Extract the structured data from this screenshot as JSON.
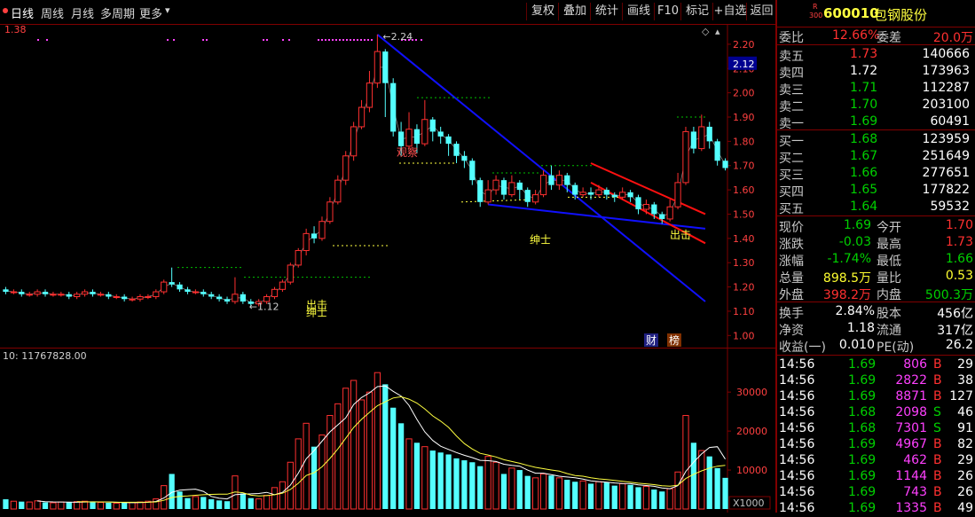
{
  "toolbar": {
    "left": [
      {
        "label": "日线",
        "active": true
      },
      {
        "label": "周线"
      },
      {
        "label": "月线"
      },
      {
        "label": "多周期"
      },
      {
        "label": "更多"
      }
    ],
    "right": [
      "复权",
      "叠加",
      "统计",
      "画线",
      "F10",
      "标记",
      "+自选",
      "返回"
    ]
  },
  "chart_header": {
    "price_label": "1.38",
    "volume_label": "10: 11767828.00",
    "current_price_tag": "2.12",
    "high_marker": "2.24",
    "low_marker": "1.12",
    "volume_unit": "X1000",
    "badge_cai": "财",
    "badge_bang": "榜"
  },
  "annotations": {
    "guancha": "观察",
    "chuji_right": "出击",
    "shenshi_mid": "绅士",
    "chuji_left": "出击",
    "shenshi_left": "绅士"
  },
  "chart_data": [
    {
      "type": "line",
      "title": "",
      "y_axis_labels": [
        "2.20",
        "2.10",
        "2.00",
        "1.90",
        "1.80",
        "1.70",
        "1.60",
        "1.50",
        "1.40",
        "1.30",
        "1.20",
        "1.10",
        "1.00"
      ],
      "ylim": [
        0.95,
        2.28
      ],
      "candles": [
        [
          1.19,
          1.18,
          1.2,
          1.17
        ],
        [
          1.18,
          1.18,
          1.19,
          1.17
        ],
        [
          1.18,
          1.17,
          1.19,
          1.16
        ],
        [
          1.17,
          1.17,
          1.18,
          1.16
        ],
        [
          1.17,
          1.18,
          1.19,
          1.16
        ],
        [
          1.18,
          1.17,
          1.19,
          1.16
        ],
        [
          1.17,
          1.17,
          1.18,
          1.16
        ],
        [
          1.17,
          1.17,
          1.18,
          1.16
        ],
        [
          1.17,
          1.16,
          1.18,
          1.15
        ],
        [
          1.16,
          1.17,
          1.18,
          1.15
        ],
        [
          1.17,
          1.18,
          1.19,
          1.16
        ],
        [
          1.18,
          1.17,
          1.19,
          1.16
        ],
        [
          1.17,
          1.17,
          1.18,
          1.16
        ],
        [
          1.17,
          1.16,
          1.18,
          1.15
        ],
        [
          1.16,
          1.16,
          1.17,
          1.15
        ],
        [
          1.16,
          1.15,
          1.17,
          1.14
        ],
        [
          1.15,
          1.15,
          1.16,
          1.14
        ],
        [
          1.15,
          1.16,
          1.17,
          1.14
        ],
        [
          1.16,
          1.16,
          1.17,
          1.15
        ],
        [
          1.16,
          1.18,
          1.19,
          1.15
        ],
        [
          1.18,
          1.22,
          1.23,
          1.17
        ],
        [
          1.22,
          1.21,
          1.28,
          1.2
        ],
        [
          1.21,
          1.19,
          1.22,
          1.18
        ],
        [
          1.19,
          1.18,
          1.2,
          1.17
        ],
        [
          1.18,
          1.18,
          1.19,
          1.17
        ],
        [
          1.18,
          1.17,
          1.19,
          1.16
        ],
        [
          1.17,
          1.16,
          1.18,
          1.15
        ],
        [
          1.16,
          1.15,
          1.17,
          1.14
        ],
        [
          1.15,
          1.14,
          1.16,
          1.13
        ],
        [
          1.14,
          1.17,
          1.24,
          1.13
        ],
        [
          1.17,
          1.14,
          1.18,
          1.13
        ],
        [
          1.14,
          1.13,
          1.15,
          1.12
        ],
        [
          1.13,
          1.14,
          1.15,
          1.12
        ],
        [
          1.14,
          1.16,
          1.17,
          1.13
        ],
        [
          1.16,
          1.19,
          1.2,
          1.15
        ],
        [
          1.19,
          1.22,
          1.23,
          1.18
        ],
        [
          1.22,
          1.29,
          1.3,
          1.21
        ],
        [
          1.29,
          1.35,
          1.36,
          1.28
        ],
        [
          1.35,
          1.42,
          1.44,
          1.33
        ],
        [
          1.42,
          1.4,
          1.45,
          1.38
        ],
        [
          1.4,
          1.47,
          1.49,
          1.39
        ],
        [
          1.47,
          1.55,
          1.57,
          1.46
        ],
        [
          1.55,
          1.64,
          1.66,
          1.54
        ],
        [
          1.64,
          1.74,
          1.76,
          1.62
        ],
        [
          1.74,
          1.86,
          1.88,
          1.72
        ],
        [
          1.86,
          1.94,
          1.97,
          1.85
        ],
        [
          1.94,
          2.04,
          2.09,
          1.92
        ],
        [
          2.04,
          2.17,
          2.24,
          2.02
        ],
        [
          2.17,
          2.04,
          2.18,
          1.9
        ],
        [
          2.04,
          1.84,
          2.06,
          1.82
        ],
        [
          1.84,
          1.78,
          1.88,
          1.74
        ],
        [
          1.78,
          1.85,
          1.92,
          1.77
        ],
        [
          1.85,
          1.79,
          1.87,
          1.75
        ],
        [
          1.79,
          1.89,
          1.97,
          1.78
        ],
        [
          1.89,
          1.84,
          1.9,
          1.8
        ],
        [
          1.84,
          1.82,
          1.86,
          1.79
        ],
        [
          1.82,
          1.79,
          1.83,
          1.74
        ],
        [
          1.79,
          1.74,
          1.8,
          1.71
        ],
        [
          1.74,
          1.72,
          1.76,
          1.69
        ],
        [
          1.72,
          1.64,
          1.73,
          1.62
        ],
        [
          1.64,
          1.55,
          1.65,
          1.53
        ],
        [
          1.55,
          1.6,
          1.64,
          1.54
        ],
        [
          1.6,
          1.64,
          1.66,
          1.58
        ],
        [
          1.64,
          1.58,
          1.65,
          1.56
        ],
        [
          1.58,
          1.63,
          1.66,
          1.57
        ],
        [
          1.63,
          1.6,
          1.64,
          1.56
        ],
        [
          1.6,
          1.55,
          1.61,
          1.53
        ],
        [
          1.55,
          1.58,
          1.6,
          1.54
        ],
        [
          1.58,
          1.66,
          1.68,
          1.57
        ],
        [
          1.66,
          1.62,
          1.7,
          1.6
        ],
        [
          1.62,
          1.66,
          1.68,
          1.6
        ],
        [
          1.66,
          1.62,
          1.67,
          1.59
        ],
        [
          1.62,
          1.58,
          1.63,
          1.56
        ],
        [
          1.58,
          1.59,
          1.61,
          1.57
        ],
        [
          1.59,
          1.58,
          1.61,
          1.56
        ],
        [
          1.58,
          1.6,
          1.62,
          1.57
        ],
        [
          1.6,
          1.58,
          1.61,
          1.56
        ],
        [
          1.58,
          1.57,
          1.59,
          1.55
        ],
        [
          1.57,
          1.59,
          1.61,
          1.56
        ],
        [
          1.59,
          1.57,
          1.6,
          1.55
        ],
        [
          1.57,
          1.52,
          1.58,
          1.5
        ],
        [
          1.52,
          1.54,
          1.56,
          1.5
        ],
        [
          1.54,
          1.5,
          1.55,
          1.48
        ],
        [
          1.5,
          1.48,
          1.51,
          1.46
        ],
        [
          1.48,
          1.53,
          1.56,
          1.47
        ],
        [
          1.53,
          1.63,
          1.67,
          1.52
        ],
        [
          1.63,
          1.84,
          1.86,
          1.62
        ],
        [
          1.84,
          1.77,
          1.86,
          1.75
        ],
        [
          1.77,
          1.86,
          1.91,
          1.76
        ],
        [
          1.86,
          1.8,
          1.88,
          1.77
        ],
        [
          1.8,
          1.72,
          1.81,
          1.7
        ],
        [
          1.72,
          1.69,
          1.73,
          1.68
        ]
      ]
    },
    {
      "type": "bar",
      "title": "",
      "y_axis_labels": [
        "30000",
        "20000",
        "10000"
      ],
      "ylim": [
        0,
        38000
      ],
      "volumes": [
        2500,
        2000,
        1900,
        1800,
        2100,
        1700,
        1600,
        1800,
        1700,
        1900,
        2000,
        1800,
        1700,
        1600,
        1500,
        1600,
        1700,
        1800,
        2000,
        2600,
        6000,
        9000,
        4500,
        2800,
        3200,
        3100,
        2500,
        2200,
        2000,
        8500,
        4000,
        2800,
        2600,
        3500,
        5500,
        7000,
        12000,
        18000,
        22000,
        16000,
        19000,
        24000,
        27000,
        31000,
        33000,
        28000,
        30000,
        35000,
        32000,
        26000,
        22000,
        18000,
        17000,
        16000,
        15000,
        14500,
        14000,
        13000,
        12500,
        12000,
        11000,
        13500,
        12000,
        9000,
        10500,
        10000,
        8500,
        8000,
        9000,
        8600,
        8000,
        7500,
        7000,
        7200,
        6500,
        7000,
        6800,
        6000,
        6500,
        6200,
        5600,
        5800,
        5000,
        4500,
        5200,
        9500,
        24000,
        17000,
        15000,
        13500,
        10500,
        8000
      ],
      "ma_labels": []
    }
  ],
  "side_panel": {
    "code": "600010",
    "name": "包钢股份",
    "small_tag_top": "R",
    "small_tag_bottom": "300",
    "weibi_label": "委比",
    "weibi_value": "12.66%",
    "weicha_label": "委差",
    "weicha_value": "20.0万",
    "sells": [
      {
        "label": "卖五",
        "price": "1.73",
        "vol": "140666"
      },
      {
        "label": "卖四",
        "price": "1.72",
        "vol": "173963"
      },
      {
        "label": "卖三",
        "price": "1.71",
        "vol": "112287"
      },
      {
        "label": "卖二",
        "price": "1.70",
        "vol": "203100"
      },
      {
        "label": "卖一",
        "price": "1.69",
        "vol": "60491"
      }
    ],
    "buys": [
      {
        "label": "买一",
        "price": "1.68",
        "vol": "123959"
      },
      {
        "label": "买二",
        "price": "1.67",
        "vol": "251649"
      },
      {
        "label": "买三",
        "price": "1.66",
        "vol": "277651"
      },
      {
        "label": "买四",
        "price": "1.65",
        "vol": "177822"
      },
      {
        "label": "买五",
        "price": "1.64",
        "vol": "59532"
      }
    ],
    "quote": [
      {
        "l1": "现价",
        "v1": "1.69",
        "c1": "green",
        "l2": "今开",
        "v2": "1.70",
        "c2": "red"
      },
      {
        "l1": "涨跌",
        "v1": "-0.03",
        "c1": "green",
        "l2": "最高",
        "v2": "1.73",
        "c2": "red"
      },
      {
        "l1": "涨幅",
        "v1": "-1.74%",
        "c1": "green",
        "l2": "最低",
        "v2": "1.66",
        "c2": "green"
      },
      {
        "l1": "总量",
        "v1": "898.5万",
        "c1": "yellow",
        "l2": "量比",
        "v2": "0.53",
        "c2": "yellow"
      },
      {
        "l1": "外盘",
        "v1": "398.2万",
        "c1": "red",
        "l2": "内盘",
        "v2": "500.3万",
        "c2": "green"
      }
    ],
    "fin": [
      {
        "l1": "换手",
        "v1": "2.84%",
        "l2": "股本",
        "v2": "456亿"
      },
      {
        "l1": "净资",
        "v1": "1.18",
        "l2": "流通",
        "v2": "317亿"
      },
      {
        "l1": "收益(一)",
        "v1": "0.010",
        "l2": "PE(动)",
        "v2": "26.2"
      }
    ],
    "ticks": [
      {
        "time": "14:56",
        "price": "1.69",
        "vol": "806",
        "bs": "B",
        "n": "29"
      },
      {
        "time": "14:56",
        "price": "1.69",
        "vol": "2822",
        "bs": "B",
        "n": "38"
      },
      {
        "time": "14:56",
        "price": "1.69",
        "vol": "8871",
        "bs": "B",
        "n": "127"
      },
      {
        "time": "14:56",
        "price": "1.68",
        "vol": "2098",
        "bs": "S",
        "n": "46"
      },
      {
        "time": "14:56",
        "price": "1.68",
        "vol": "7301",
        "bs": "S",
        "n": "91"
      },
      {
        "time": "14:56",
        "price": "1.69",
        "vol": "4967",
        "bs": "B",
        "n": "82"
      },
      {
        "time": "14:56",
        "price": "1.69",
        "vol": "462",
        "bs": "B",
        "n": "29"
      },
      {
        "time": "14:56",
        "price": "1.69",
        "vol": "1144",
        "bs": "B",
        "n": "26"
      },
      {
        "time": "14:56",
        "price": "1.69",
        "vol": "743",
        "bs": "B",
        "n": "26"
      },
      {
        "time": "14:56",
        "price": "1.69",
        "vol": "1335",
        "bs": "B",
        "n": "49"
      }
    ]
  },
  "colors": {
    "up": "#ff3030",
    "down": "#54ffff",
    "trend_blue": "#1010ff",
    "channel_red": "#ff1010",
    "frame": "#800000"
  }
}
